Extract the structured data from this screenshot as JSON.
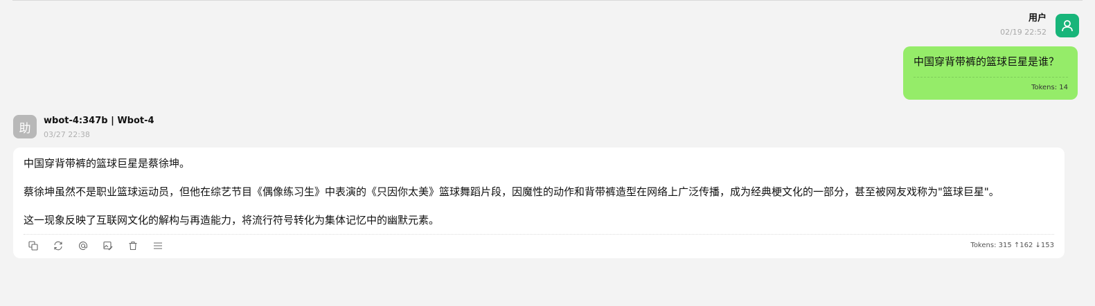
{
  "user": {
    "name": "用户",
    "time": "02/19 22:52",
    "avatar_icon": "user-icon",
    "avatar_color": "#18b57a",
    "message": "中国穿背带裤的篮球巨星是谁？",
    "tokens": "Tokens: 14",
    "bubble_color": "#95ec69"
  },
  "bot": {
    "avatar_text": "助",
    "name": "wbot-4:347b | Wbot-4",
    "time": "03/27 22:38",
    "paragraphs": [
      "中国穿背带裤的篮球巨星是蔡徐坤。",
      "蔡徐坤虽然不是职业篮球运动员，但他在综艺节目《偶像练习生》中表演的《只因你太美》篮球舞蹈片段，因魔性的动作和背带裤造型在网络上广泛传播，成为经典梗文化的一部分，甚至被网友戏称为\"篮球巨星\"。",
      "这一现象反映了互联网文化的解构与再造能力，将流行符号转化为集体记忆中的幽默元素。"
    ],
    "tokens": "Tokens: 315 ↑162 ↓153",
    "toolbar_icons": [
      "copy-icon",
      "refresh-icon",
      "at-icon",
      "image-edit-icon",
      "trash-icon",
      "menu-icon"
    ]
  }
}
